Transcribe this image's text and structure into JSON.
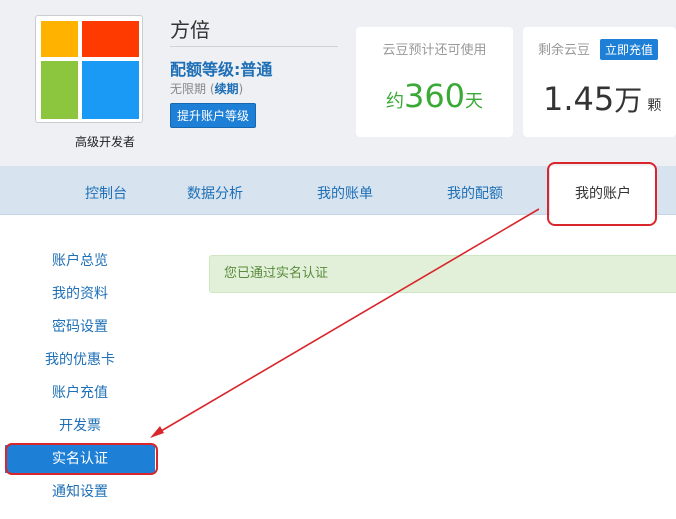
{
  "profile": {
    "username": "方倍",
    "role": "高级开发者",
    "quota_level": "配额等级:普通",
    "validity_prefix": "无限期 (",
    "validity_renew": "续期",
    "validity_suffix": ")",
    "upgrade_label": "提升账户等级"
  },
  "stats": {
    "estimate": {
      "label": "云豆预计还可使用",
      "prefix": "约",
      "value": "360",
      "unit": "天"
    },
    "remaining": {
      "label": "剩余云豆",
      "recharge_label": "立即充值",
      "value": "1.45",
      "unit": "万",
      "unit2": "颗"
    }
  },
  "nav": {
    "tabs": [
      {
        "label": "控制台"
      },
      {
        "label": "数据分析"
      },
      {
        "label": "我的账单"
      },
      {
        "label": "我的配额"
      },
      {
        "label": "我的账户"
      }
    ],
    "active": "我的账户"
  },
  "sidebar": {
    "items": [
      {
        "label": "账户总览"
      },
      {
        "label": "我的资料"
      },
      {
        "label": "密码设置"
      },
      {
        "label": "我的优惠卡"
      },
      {
        "label": "账户充值"
      },
      {
        "label": "开发票"
      },
      {
        "label": "实名认证"
      },
      {
        "label": "通知设置"
      }
    ],
    "selected": "实名认证"
  },
  "main": {
    "notice": "您已通过实名认证"
  },
  "colors": {
    "link_blue": "#1e6fb6",
    "button_blue": "#1e7fd6",
    "success_green": "#3aa935",
    "annotation_red": "#d9262c"
  }
}
